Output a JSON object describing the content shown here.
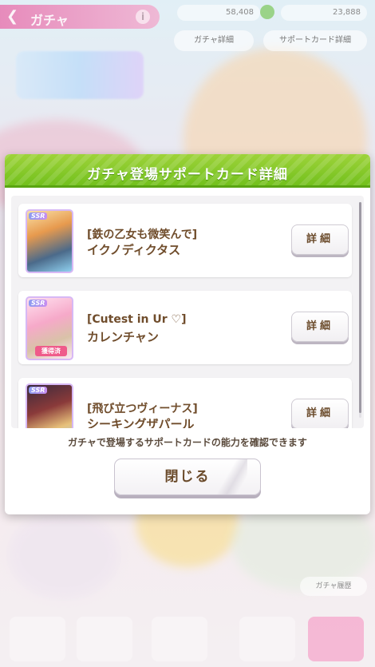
{
  "topbar": {
    "back_label": "ガチャ",
    "info_label": "i",
    "currency1": "58,408",
    "currency2": "23,888",
    "btn_gacha_detail": "ガチャ詳細",
    "btn_support_detail": "サポートカード詳細"
  },
  "modal": {
    "title": "ガチャ登場サポートカード詳細",
    "cards": [
      {
        "rarity": "SSR",
        "title": "[鉄の乙女も微笑んで]",
        "name": "イクノディクタス",
        "owned": "",
        "detail": "詳細"
      },
      {
        "rarity": "SSR",
        "title": "[Cutest in Ur ♡]",
        "name": "カレンチャン",
        "owned": "獲得済",
        "detail": "詳細"
      },
      {
        "rarity": "SSR",
        "title": "[飛び立つヴィーナス]",
        "name": "シーキングザパール",
        "owned": "",
        "detail": "詳細"
      }
    ],
    "info_text": "ガチャで登場するサポートカードの能力を確認できます",
    "close_label": "閉じる"
  },
  "background": {
    "gacha_record_label": "ガチャ履歴"
  },
  "colors": {
    "header_green": "#7cc524",
    "text_brown": "#704d2c",
    "owned_pink": "#ef5b8b"
  }
}
